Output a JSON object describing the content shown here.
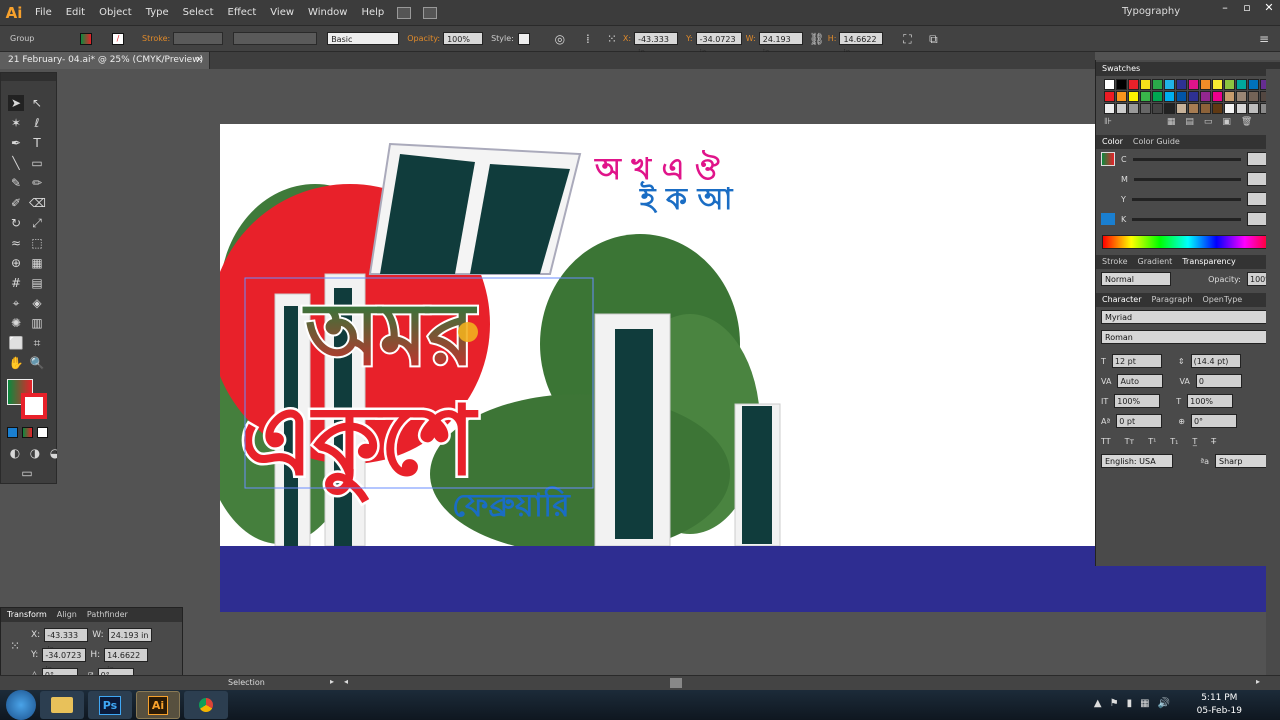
{
  "app": {
    "logo": "Ai",
    "workspace": "Typography"
  },
  "menu": [
    "File",
    "Edit",
    "Object",
    "Type",
    "Select",
    "Effect",
    "View",
    "Window",
    "Help"
  ],
  "control": {
    "selection": "Group",
    "stroke_label": "Stroke:",
    "brush": "Basic",
    "opacity_label": "Opacity:",
    "opacity": "100%",
    "style_label": "Style:",
    "x_label": "X:",
    "x": "-43.333 in",
    "y_label": "Y:",
    "y": "-34.0723 in",
    "w_label": "W:",
    "w": "24.193 in",
    "h_label": "H:",
    "h": "14.6622 in"
  },
  "document": {
    "tab": "21 February- 04.ai* @ 25% (CMYK/Preview)",
    "close": "×"
  },
  "artwork": {
    "letters_top": "অ খ এ ঔ",
    "letters_bottom": "ই ক আ",
    "main_line1": "অমর",
    "main_line2": "একুশে",
    "sub": "ফেব্রুয়ারি"
  },
  "panels": {
    "swatches_title": "Swatches",
    "color_tabs": [
      "Color",
      "Color Guide"
    ],
    "cmyk": [
      "C",
      "M",
      "Y",
      "K"
    ],
    "transparency_tabs": [
      "Stroke",
      "Gradient",
      "Transparency"
    ],
    "blend_mode": "Normal",
    "opacity_label": "Opacity:",
    "opacity": "100%",
    "character_tabs": [
      "Character",
      "Paragraph",
      "OpenType"
    ],
    "font": "Myriad",
    "font_style": "Roman",
    "font_size": "12 pt",
    "leading": "(14.4 pt)",
    "kerning": "Auto",
    "tracking": "0",
    "v_scale": "100%",
    "h_scale": "100%",
    "baseline": "0 pt",
    "rotation": "0°",
    "language": "English: USA",
    "antialias": "Sharp"
  },
  "transform_panel": {
    "tabs": [
      "Transform",
      "Align",
      "Pathfinder"
    ],
    "x_label": "X:",
    "x": "-43.333 in",
    "w_label": "W:",
    "w": "24.193 in",
    "y_label": "Y:",
    "y": "-34.0723 in",
    "h_label": "H:",
    "h": "14.6622 in",
    "rotate": "0°",
    "shear": "0°"
  },
  "status": {
    "tool": "Selection"
  },
  "taskbar": {
    "time": "5:11 PM",
    "date": "05-Feb-19",
    "apps": [
      "Ps",
      "Ai"
    ]
  },
  "colors": {
    "accent": "#f7a12c",
    "blue_bar": "#2e2d91",
    "red": "#e8212a",
    "green": "#0a8a3e"
  }
}
